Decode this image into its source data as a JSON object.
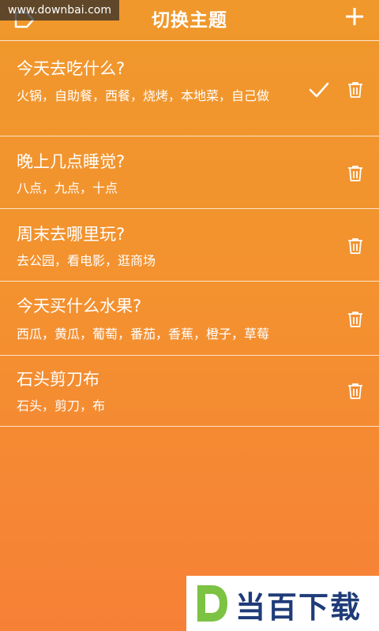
{
  "header": {
    "title": "切换主题",
    "back_icon": "back-icon",
    "add_icon": "plus-icon"
  },
  "watermark": "www.downbai.com",
  "topics": [
    {
      "title": "今天去吃什么?",
      "options": "火锅，自助餐，西餐，烧烤，本地菜，自己做",
      "selected": true
    },
    {
      "title": "晚上几点睡觉?",
      "options": "八点，九点，十点",
      "selected": false
    },
    {
      "title": "周末去哪里玩?",
      "options": "去公园，看电影，逛商场",
      "selected": false
    },
    {
      "title": "今天买什么水果?",
      "options": "西瓜，黄瓜，葡萄，番茄，香蕉，橙子，草莓",
      "selected": false
    },
    {
      "title": "石头剪刀布",
      "options": "石头，剪刀，布",
      "selected": false
    }
  ],
  "brand": {
    "text": "当百下载",
    "logo_letter": "D"
  },
  "colors": {
    "background_top": "#f0982c",
    "background_bottom": "#f78037",
    "brand_text": "#1f3b78",
    "logo_green": "#7cc243"
  }
}
